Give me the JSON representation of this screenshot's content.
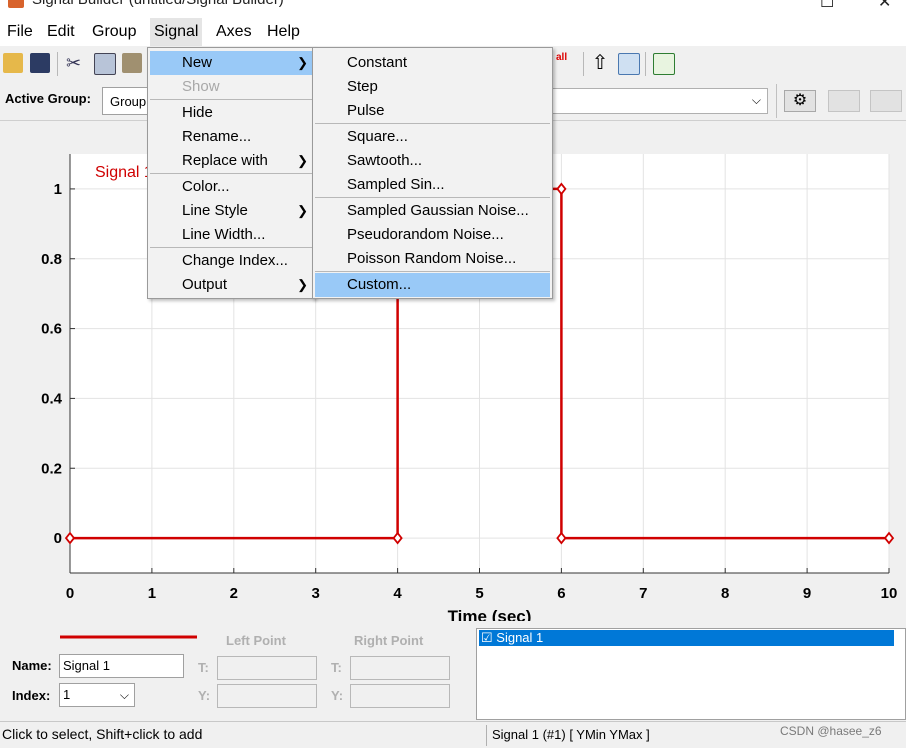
{
  "window": {
    "title": "Signal Builder (untitled/Signal Builder)",
    "min": "—",
    "max": "☐",
    "close": "✕"
  },
  "menubar": [
    "File",
    "Edit",
    "Group",
    "Signal",
    "Axes",
    "Help"
  ],
  "toolbar": {
    "icons": [
      "open-icon",
      "save-icon",
      "cut-icon",
      "copy-icon",
      "paste-icon",
      "delete-all-icon",
      "move-up-icon",
      "import-icon",
      "export-icon"
    ],
    "badge_text": "all"
  },
  "group_bar": {
    "label": "Active Group:",
    "tab_label": "Group",
    "dropdown_value": ""
  },
  "signal_menu": {
    "items": [
      {
        "label": "New",
        "submenu": true,
        "highlighted": true
      },
      {
        "label": "Show",
        "disabled": true
      },
      {
        "label": "Hide"
      },
      {
        "label": "Rename..."
      },
      {
        "label": "Replace with",
        "submenu": true
      },
      {
        "label": "Color..."
      },
      {
        "label": "Line Style",
        "submenu": true
      },
      {
        "label": "Line Width..."
      },
      {
        "label": "Change Index..."
      },
      {
        "label": "Output",
        "submenu": true
      }
    ]
  },
  "new_submenu": {
    "items": [
      "Constant",
      "Step",
      "Pulse",
      "Square...",
      "Sawtooth...",
      "Sampled Sin...",
      "Sampled Gaussian Noise...",
      "Pseudorandom Noise...",
      "Poisson Random Noise...",
      "Custom..."
    ],
    "highlighted": "Custom..."
  },
  "chart_data": {
    "type": "line",
    "series": [
      {
        "name": "Signal 1",
        "color": "#d00000",
        "x": [
          0,
          4,
          4,
          6,
          6,
          10
        ],
        "y": [
          0,
          0,
          1,
          1,
          0,
          0
        ]
      }
    ],
    "xlabel": "Time (sec)",
    "xlim": [
      0,
      10
    ],
    "ylim": [
      -0.1,
      1.1
    ],
    "xticks": [
      0,
      1,
      2,
      3,
      4,
      5,
      6,
      7,
      8,
      9,
      10
    ],
    "yticks": [
      0,
      0.2,
      0.4,
      0.6,
      0.8,
      1
    ],
    "ytick_labels": [
      "0",
      "0.2",
      "0.4",
      "0.6",
      "0.8",
      "1"
    ],
    "grid": true
  },
  "bottom_panel": {
    "name_label": "Name:",
    "name_value": "Signal 1",
    "index_label": "Index:",
    "index_value": "1",
    "left_point": "Left Point",
    "right_point": "Right Point",
    "t_label": "T:",
    "y_label": "Y:",
    "signal_list": [
      "Signal 1"
    ],
    "line_color": "#d00000"
  },
  "status": {
    "left": "Click to select, Shift+click to add",
    "right": "Signal 1 (#1)  [ YMin YMax ]",
    "watermark": "CSDN @hasee_z6"
  }
}
